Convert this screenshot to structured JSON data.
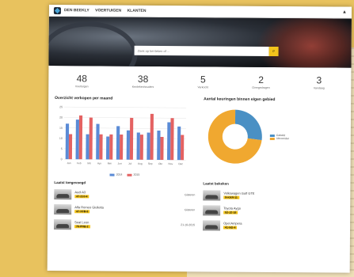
{
  "nav": {
    "items": [
      "DEN BEEKLY",
      "VOERTUIGEN",
      "KLANTEN"
    ]
  },
  "search": {
    "placeholder": "Zoek op kenteken of ..."
  },
  "stats": [
    {
      "value": "48",
      "label": "Voertuigen"
    },
    {
      "value": "38",
      "label": "Kentekenhouders"
    },
    {
      "value": "5",
      "label": "Verkocht"
    },
    {
      "value": "2",
      "label": "Overgedragen"
    },
    {
      "value": "3",
      "label": "Vandaag"
    }
  ],
  "bar_chart_title": "Overzicht verkopen per maand",
  "pie_chart_title": "Aantal keuringen binnen eigen gebied",
  "chart_data": [
    {
      "type": "bar",
      "title": "Overzicht verkopen per maand",
      "categories": [
        "Jan",
        "Feb",
        "Mrt",
        "Apr",
        "Mei",
        "Jun",
        "Jul",
        "Aug",
        "Sep",
        "Okt",
        "Nov",
        "Dec"
      ],
      "series": [
        {
          "name": "2014",
          "values": [
            17,
            19,
            12,
            17,
            11,
            16,
            14,
            13,
            13,
            14,
            18,
            16
          ],
          "color": "#5b8bd6"
        },
        {
          "name": "2015",
          "values": [
            12,
            21,
            20,
            12,
            12,
            12,
            20,
            12,
            22,
            11,
            20,
            12
          ],
          "color": "#e46262"
        }
      ],
      "ylim": [
        0,
        25
      ],
      "yticks": [
        0,
        5,
        10,
        15,
        20,
        25
      ]
    },
    {
      "type": "pie",
      "title": "Aantal keuringen binnen eigen gebied",
      "slices": [
        {
          "name": "Gebeld",
          "value": 27,
          "color": "#4a90c4"
        },
        {
          "name": "Uitvoerder",
          "value": 73,
          "color": "#f0a830"
        }
      ],
      "labels": [
        "Gebeld",
        "Uitvoerder"
      ]
    }
  ],
  "lists": {
    "left_title": "Laatst toegevoegd",
    "left": [
      {
        "name": "Audi A3",
        "plate": "47-ZJJ-4",
        "meta": "Gisteren"
      },
      {
        "name": "Alfa Romeo Giulietta",
        "plate": "47-XFB-8",
        "meta": "Gisteren"
      },
      {
        "name": "Seat Leon",
        "plate": "76-PHB-2",
        "meta": "21-10-2015"
      }
    ],
    "right_title": "Laatst bekeken",
    "right": [
      {
        "name": "Volkswagen Golf GTE",
        "plate": "9-KKR-11"
      },
      {
        "name": "Toyota Aygo",
        "plate": "52-JZ-18"
      },
      {
        "name": "Opel Ampera",
        "plate": "41-NG-4"
      }
    ]
  }
}
